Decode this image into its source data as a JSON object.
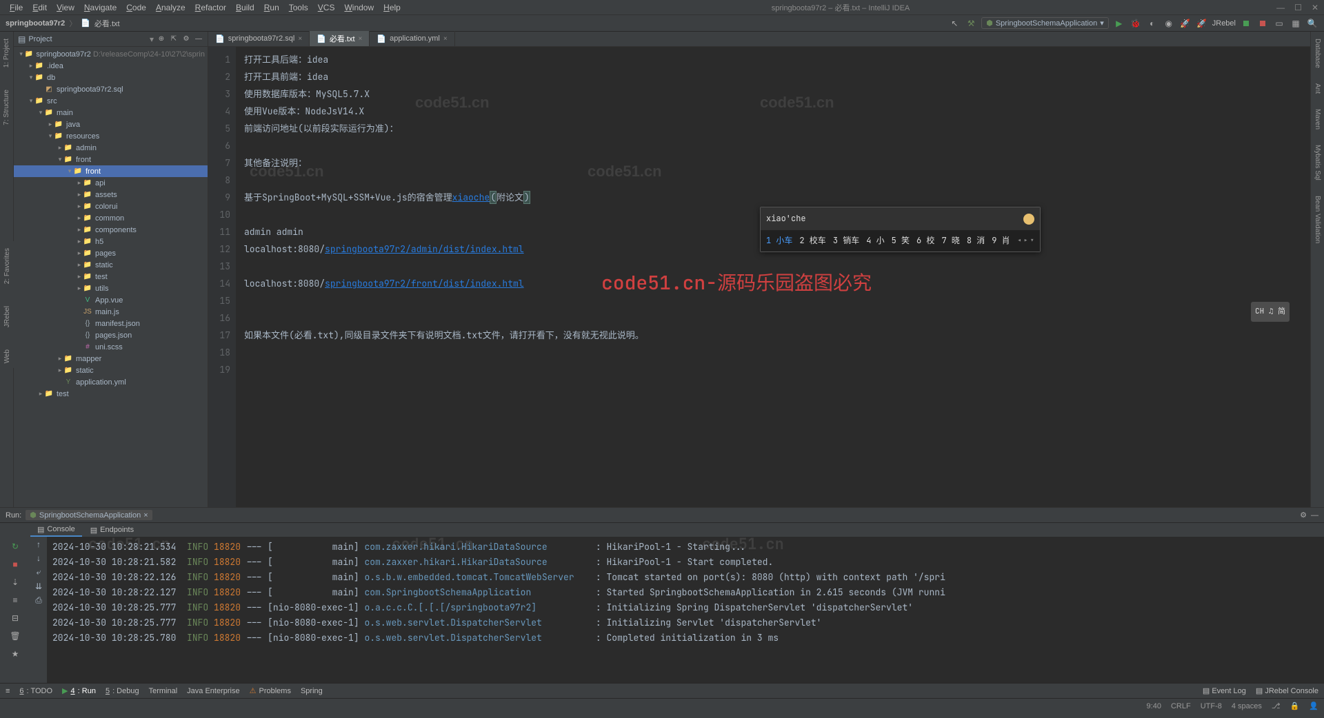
{
  "titlebar": {
    "menus": [
      "File",
      "Edit",
      "View",
      "Navigate",
      "Code",
      "Analyze",
      "Refactor",
      "Build",
      "Run",
      "Tools",
      "VCS",
      "Window",
      "Help"
    ],
    "title": "springboota97r2 – 必看.txt – IntelliJ IDEA"
  },
  "breadcrumb": {
    "project": "springboota97r2",
    "file": "必看.txt"
  },
  "run_config": {
    "name": "SpringbootSchemaApplication",
    "jrebel_label": "JRebel"
  },
  "project_header": {
    "title": "Project"
  },
  "tree": [
    {
      "d": 0,
      "l": "springboota97r2",
      "suffix": " D:\\releaseComp\\24-10\\27\\2\\sprin",
      "exp": true,
      "type": "proj"
    },
    {
      "d": 1,
      "l": ".idea",
      "type": "dir"
    },
    {
      "d": 1,
      "l": "db",
      "exp": true,
      "type": "dir"
    },
    {
      "d": 2,
      "l": "springboota97r2.sql",
      "type": "sql"
    },
    {
      "d": 1,
      "l": "src",
      "exp": true,
      "type": "dir",
      "blue": true
    },
    {
      "d": 2,
      "l": "main",
      "exp": true,
      "type": "dir"
    },
    {
      "d": 3,
      "l": "java",
      "type": "dir",
      "blue": true
    },
    {
      "d": 3,
      "l": "resources",
      "exp": true,
      "type": "dir"
    },
    {
      "d": 4,
      "l": "admin",
      "type": "dir"
    },
    {
      "d": 4,
      "l": "front",
      "exp": true,
      "type": "dir"
    },
    {
      "d": 5,
      "l": "front",
      "exp": true,
      "type": "dir",
      "sel": true
    },
    {
      "d": 6,
      "l": "api",
      "type": "dir"
    },
    {
      "d": 6,
      "l": "assets",
      "type": "dir"
    },
    {
      "d": 6,
      "l": "colorui",
      "type": "dir"
    },
    {
      "d": 6,
      "l": "common",
      "type": "dir"
    },
    {
      "d": 6,
      "l": "components",
      "type": "dir"
    },
    {
      "d": 6,
      "l": "h5",
      "type": "dir"
    },
    {
      "d": 6,
      "l": "pages",
      "type": "dir"
    },
    {
      "d": 6,
      "l": "static",
      "type": "dir"
    },
    {
      "d": 6,
      "l": "test",
      "type": "dir"
    },
    {
      "d": 6,
      "l": "utils",
      "type": "dir"
    },
    {
      "d": 6,
      "l": "App.vue",
      "type": "vue"
    },
    {
      "d": 6,
      "l": "main.js",
      "type": "js"
    },
    {
      "d": 6,
      "l": "manifest.json",
      "type": "json"
    },
    {
      "d": 6,
      "l": "pages.json",
      "type": "json"
    },
    {
      "d": 6,
      "l": "uni.scss",
      "type": "scss"
    },
    {
      "d": 4,
      "l": "mapper",
      "type": "dir"
    },
    {
      "d": 4,
      "l": "static",
      "type": "dir"
    },
    {
      "d": 4,
      "l": "application.yml",
      "type": "yml"
    },
    {
      "d": 2,
      "l": "test",
      "type": "dir"
    }
  ],
  "editor_tabs": [
    {
      "label": "springboota97r2.sql",
      "active": false
    },
    {
      "label": "必看.txt",
      "active": true
    },
    {
      "label": "application.yml",
      "active": false
    }
  ],
  "code_lines": [
    "打开工具后端：idea",
    "打开工具前端：idea",
    "使用数据库版本：MySQL5.7.X",
    "使用Vue版本：NodeJsV14.X",
    "前端访问地址(以前段实际运行为准)：",
    "",
    "其他备注说明：",
    "",
    "基于SpringBoot+MySQL+SSM+Vue.js的宿舍管理xiaoche(附论文)",
    "",
    "admin admin",
    "localhost:8080/springboota97r2/admin/dist/index.html",
    "",
    "localhost:8080/springboota97r2/front/dist/index.html",
    "",
    "",
    "如果本文件(必看.txt),同级目录文件夹下有说明文档.txt文件，请打开看下，没有就无视此说明。",
    "",
    ""
  ],
  "ime": {
    "input": "xiao'che",
    "candidates": [
      "1 小车",
      "2 校车",
      "3 销车",
      "4 小",
      "5 笑",
      "6 校",
      "7 晓",
      "8 消",
      "9 肖"
    ]
  },
  "ime_badge": "CH ♫ 简",
  "watermark": "code51.cn",
  "wm_red": "code51.cn-源码乐园盗图必究",
  "left_tabs": [
    "1: Project",
    "7: Structure"
  ],
  "left_tabs2": [
    "2: Favorites",
    "JRebel",
    "Web"
  ],
  "right_tabs": [
    "Database",
    "Ant",
    "Maven",
    "Mybatis Sql",
    "Bean Validation"
  ],
  "run": {
    "label": "Run:",
    "config": "SpringbootSchemaApplication",
    "tabs": [
      {
        "label": "Console",
        "active": true
      },
      {
        "label": "Endpoints",
        "active": false
      }
    ]
  },
  "log_lines": [
    {
      "ts": "2024-10-30 10:28:21.534",
      "lvl": "INFO",
      "pid": "18820",
      "thread": "[           main]",
      "cls": "com.zaxxer.hikari.HikariDataSource",
      "msg": ": HikariPool-1 - Starting..."
    },
    {
      "ts": "2024-10-30 10:28:21.582",
      "lvl": "INFO",
      "pid": "18820",
      "thread": "[           main]",
      "cls": "com.zaxxer.hikari.HikariDataSource",
      "msg": ": HikariPool-1 - Start completed."
    },
    {
      "ts": "2024-10-30 10:28:22.126",
      "lvl": "INFO",
      "pid": "18820",
      "thread": "[           main]",
      "cls": "o.s.b.w.embedded.tomcat.TomcatWebServer",
      "msg": ": Tomcat started on port(s): 8080 (http) with context path '/spri"
    },
    {
      "ts": "2024-10-30 10:28:22.127",
      "lvl": "INFO",
      "pid": "18820",
      "thread": "[           main]",
      "cls": "com.SpringbootSchemaApplication",
      "msg": ": Started SpringbootSchemaApplication in 2.615 seconds (JVM runni"
    },
    {
      "ts": "2024-10-30 10:28:25.777",
      "lvl": "INFO",
      "pid": "18820",
      "thread": "[nio-8080-exec-1]",
      "cls": "o.a.c.c.C.[.[.[/springboota97r2]",
      "msg": ": Initializing Spring DispatcherServlet 'dispatcherServlet'"
    },
    {
      "ts": "2024-10-30 10:28:25.777",
      "lvl": "INFO",
      "pid": "18820",
      "thread": "[nio-8080-exec-1]",
      "cls": "o.s.web.servlet.DispatcherServlet",
      "msg": ": Initializing Servlet 'dispatcherServlet'"
    },
    {
      "ts": "2024-10-30 10:28:25.780",
      "lvl": "INFO",
      "pid": "18820",
      "thread": "[nio-8080-exec-1]",
      "cls": "o.s.web.servlet.DispatcherServlet",
      "msg": ": Completed initialization in 3 ms"
    }
  ],
  "bottom_tabs": [
    {
      "label": "≡",
      "icon": true
    },
    {
      "label": "6: TODO",
      "u": "6"
    },
    {
      "label": "4: Run",
      "u": "4",
      "active": true
    },
    {
      "label": "5: Debug",
      "u": "5"
    },
    {
      "label": "Terminal"
    },
    {
      "label": "Java Enterprise"
    },
    {
      "label": "Problems",
      "warn": true
    },
    {
      "label": "Spring"
    }
  ],
  "bottom_right": [
    {
      "label": "Event Log"
    },
    {
      "label": "JRebel Console"
    }
  ],
  "status": {
    "pos": "9:40",
    "eol": "CRLF",
    "enc": "UTF-8",
    "indent": "4 spaces",
    "git": "⎇"
  }
}
